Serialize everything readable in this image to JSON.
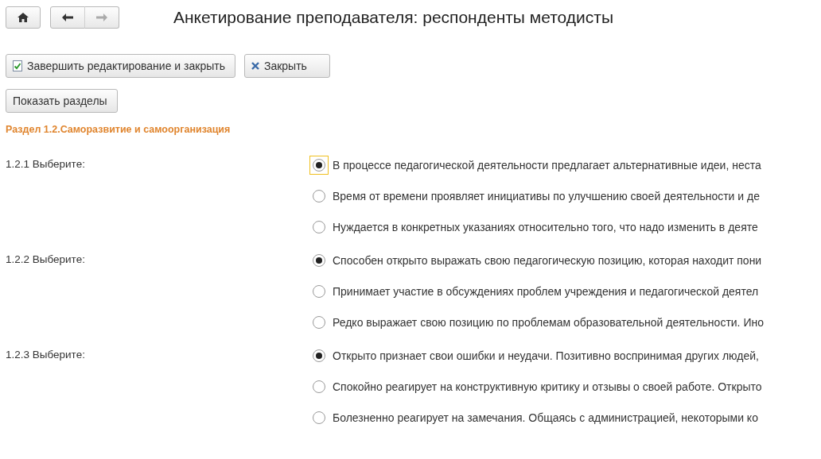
{
  "window": {
    "title": "Анкетирование преподавателя: респонденты методисты"
  },
  "commands": [
    {
      "kind": "save",
      "label": "Завершить редактирование и закрыть"
    },
    {
      "kind": "close",
      "label": "Закрыть"
    }
  ],
  "sections_button": {
    "label": "Показать разделы"
  },
  "section": {
    "title": "Раздел 1.2.Саморазвитие и самоорганизация"
  },
  "questions": [
    {
      "label": "1.2.1 Выберите:",
      "options": [
        {
          "text": "В процессе педагогической деятельности предлагает альтернативные идеи, неста",
          "selected": true,
          "focused": true
        },
        {
          "text": "Время от времени проявляет инициативы по улучшению своей деятельности и де",
          "selected": false,
          "focused": false
        },
        {
          "text": "Нуждается в конкретных указаниях относительно того, что надо изменить в деяте",
          "selected": false,
          "focused": false
        }
      ]
    },
    {
      "label": "1.2.2 Выберите:",
      "options": [
        {
          "text": "Способен открыто выражать свою педагогическую позицию, которая находит пони",
          "selected": true,
          "focused": false
        },
        {
          "text": "Принимает участие в обсуждениях проблем учреждения и педагогической деятел",
          "selected": false,
          "focused": false
        },
        {
          "text": "Редко выражает свою позицию по проблемам образовательной деятельности. Ино",
          "selected": false,
          "focused": false
        }
      ]
    },
    {
      "label": "1.2.3 Выберите:",
      "options": [
        {
          "text": "Открыто признает свои ошибки и неудачи. Позитивно воспринимая других людей,",
          "selected": true,
          "focused": false
        },
        {
          "text": "Спокойно реагирует на конструктивную критику и отзывы о своей работе. Открыто",
          "selected": false,
          "focused": false
        },
        {
          "text": "Болезненно реагирует на замечания. Общаясь с администрацией, некоторыми ко",
          "selected": false,
          "focused": false
        }
      ]
    }
  ]
}
